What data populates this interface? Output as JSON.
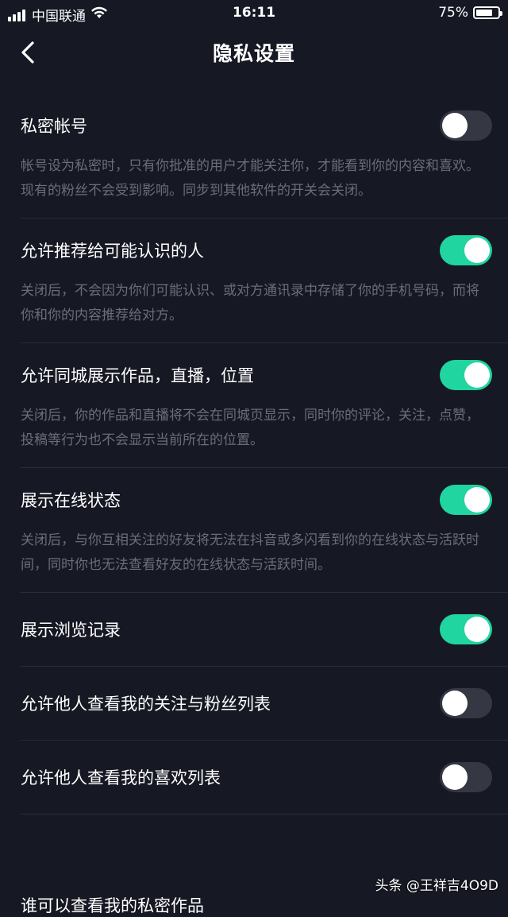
{
  "status_bar": {
    "carrier": "中国联通",
    "time": "16:11",
    "battery_text": "75%",
    "battery_level": 0.75
  },
  "header": {
    "title": "隐私设置"
  },
  "settings": [
    {
      "label": "私密帐号",
      "enabled": false,
      "description": "帐号设为私密时，只有你批准的用户才能关注你，才能看到你的内容和喜欢。现有的粉丝不会受到影响。同步到其他软件的开关会关闭。"
    },
    {
      "label": "允许推荐给可能认识的人",
      "enabled": true,
      "description": "关闭后，不会因为你们可能认识、或对方通讯录中存储了你的手机号码，而将你和你的内容推荐给对方。"
    },
    {
      "label": "允许同城展示作品，直播，位置",
      "enabled": true,
      "description": "关闭后，你的作品和直播将不会在同城页显示，同时你的评论，关注，点赞，投稿等行为也不会显示当前所在的位置。"
    },
    {
      "label": "展示在线状态",
      "enabled": true,
      "description": "关闭后，与你互相关注的好友将无法在抖音或多闪看到你的在线状态与活跃时间，同时你也无法查看好友的在线状态与活跃时间。"
    },
    {
      "label": "展示浏览记录",
      "enabled": true,
      "description": ""
    },
    {
      "label": "允许他人查看我的关注与粉丝列表",
      "enabled": false,
      "description": ""
    },
    {
      "label": "允许他人查看我的喜欢列表",
      "enabled": false,
      "description": ""
    }
  ],
  "partial_item_label": "谁可以查看我的私密作品",
  "watermark": "头条 @王祥吉4O9D",
  "colors": {
    "background": "#161823",
    "toggle_on": "#20d5a0",
    "toggle_off": "#353742",
    "description_text": "#6b6d78"
  },
  "icons": {
    "back": "chevron-left-icon",
    "signal": "signal-icon",
    "wifi": "wifi-icon",
    "battery": "battery-icon"
  }
}
